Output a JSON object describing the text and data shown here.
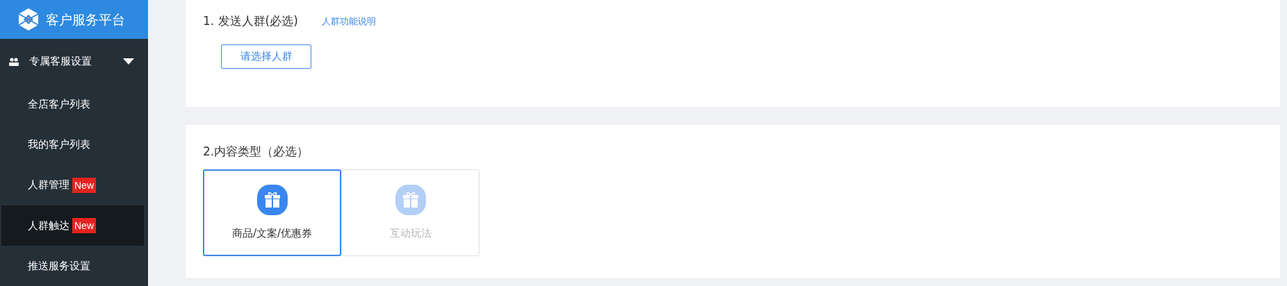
{
  "sidebar": {
    "brand": "客户服务平台",
    "group": {
      "label": "专属客服设置",
      "expanded": true,
      "items": [
        {
          "label": "全店客户列表",
          "selected": false
        },
        {
          "label": "我的客户列表",
          "selected": false
        },
        {
          "label": "人群管理",
          "badge": "New",
          "selected": false
        },
        {
          "label": "人群触达",
          "badge": "New",
          "selected": true
        },
        {
          "label": "推送服务设置",
          "selected": false
        }
      ]
    }
  },
  "audience_section": {
    "title": "1. 发送人群(必选)",
    "help_link": "人群功能说明",
    "button": "请选择人群"
  },
  "content_section": {
    "title": "2.内容类型（必选）",
    "options": [
      {
        "label": "商品/文案/优惠券",
        "selected": true,
        "disabled": false
      },
      {
        "label": "互动玩法",
        "selected": false,
        "disabled": true
      }
    ]
  }
}
